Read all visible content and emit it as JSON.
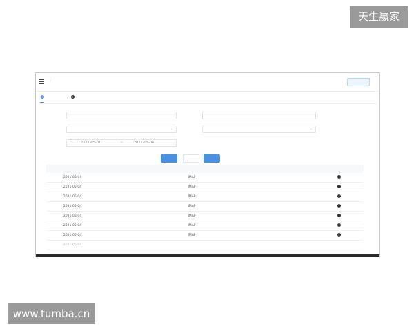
{
  "watermarks": {
    "top": "天生赢家",
    "bottom": "www.tumba.cn"
  },
  "topbar": {
    "crumb_root": "",
    "crumb_current": "",
    "current_account_label": "",
    "current_account_value": "",
    "switch_button": ""
  },
  "tabs": [
    {
      "label": ""
    },
    {
      "label": ""
    }
  ],
  "filters": {
    "mail_account_label": "",
    "mail_account_value": "",
    "login_ip_label": "",
    "login_ip_value": "",
    "ip_location_label": "",
    "ip_location_value": "",
    "risk_label": "",
    "risk_value": "",
    "query_time_label": "",
    "date_start": "2021-05-01",
    "date_sep": "~",
    "date_end": "2021-05-04"
  },
  "buttons": {
    "query": "",
    "reset": "",
    "export": ""
  },
  "table": {
    "headers": [
      "",
      "",
      "",
      "",
      "",
      ""
    ],
    "rows": [
      [
        "2021-05-04",
        "",
        "IMAP",
        "",
        "",
        ""
      ],
      [
        "2021-05-04",
        "",
        "IMAP",
        "",
        "",
        ""
      ],
      [
        "2021-05-04",
        "",
        "IMAP",
        "",
        "",
        ""
      ],
      [
        "2021-05-04",
        "",
        "IMAP",
        "",
        "",
        ""
      ],
      [
        "2021-05-04",
        "",
        "IMAP",
        "",
        "",
        ""
      ],
      [
        "2021-05-04",
        "",
        "IMAP",
        "",
        "",
        ""
      ],
      [
        "2021-05-04",
        "",
        "IMAP",
        "",
        "",
        ""
      ],
      [
        "2021-05-04",
        "",
        "",
        "",
        "",
        ""
      ]
    ]
  },
  "colors": {
    "accent": "#4a90e2",
    "watermark_bg": "#9a9a9a"
  }
}
